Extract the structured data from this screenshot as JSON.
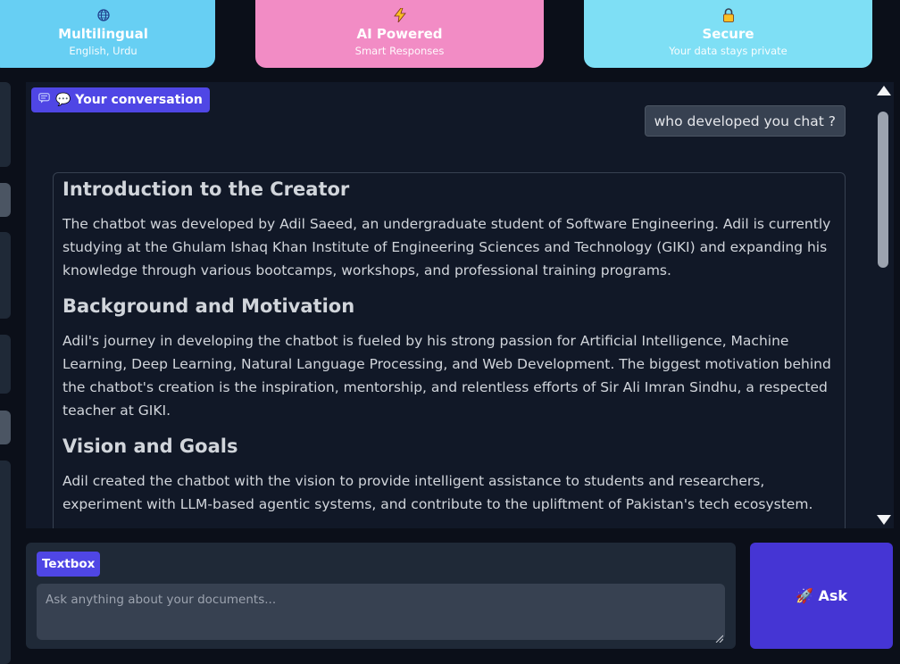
{
  "features": [
    {
      "title": "Multilingual",
      "subtitle": "English, Urdu",
      "icon": "globe-icon"
    },
    {
      "title": "AI Powered",
      "subtitle": "Smart Responses",
      "icon": "lightning-icon"
    },
    {
      "title": "Secure",
      "subtitle": "Your data stays private",
      "icon": "lock-icon"
    }
  ],
  "chat": {
    "label": "💬 Your conversation",
    "user_message": "who developed you chat ?",
    "bot_message": {
      "sections": [
        {
          "heading": "Introduction to the Creator",
          "body": "The chatbot was developed by Adil Saeed, an undergraduate student of Software Engineering. Adil is currently studying at the Ghulam Ishaq Khan Institute of Engineering Sciences and Technology (GIKI) and expanding his knowledge through various bootcamps, workshops, and professional training programs."
        },
        {
          "heading": "Background and Motivation",
          "body": "Adil's journey in developing the chatbot is fueled by his strong passion for Artificial Intelligence, Machine Learning, Deep Learning, Natural Language Processing, and Web Development. The biggest motivation behind the chatbot's creation is the inspiration, mentorship, and relentless efforts of Sir Ali Imran Sindhu, a respected teacher at GIKI."
        },
        {
          "heading": "Vision and Goals",
          "body": "Adil created the chatbot with the vision to provide intelligent assistance to students and researchers, experiment with LLM-based agentic systems, and contribute to the upliftment of Pakistan's tech ecosystem."
        }
      ]
    }
  },
  "input": {
    "label": "Textbox",
    "placeholder": "Ask anything about your documents...",
    "value": ""
  },
  "ask_button": {
    "label": "🚀 Ask"
  },
  "colors": {
    "multilingual_card": "#67cff3",
    "ai_card": "#f28cc5",
    "secure_card": "#7edff5",
    "accent": "#4f46e5",
    "ask_button": "#4535d4",
    "panel_bg": "#111827"
  }
}
